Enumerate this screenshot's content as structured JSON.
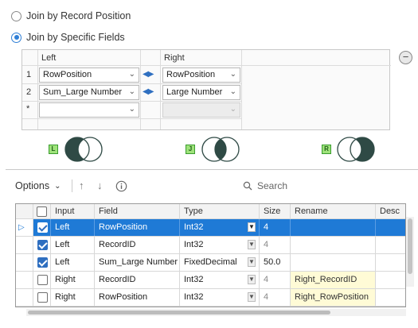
{
  "join_mode": {
    "by_position_label": "Join by Record Position",
    "by_fields_label": "Join by Specific Fields",
    "selected": "by_fields"
  },
  "join_grid": {
    "left_header": "Left",
    "right_header": "Right",
    "rows": [
      {
        "num": "1",
        "left": "RowPosition",
        "right": "RowPosition"
      },
      {
        "num": "2",
        "left": "Sum_Large Number",
        "right": "Large Number"
      },
      {
        "num": "*",
        "left": "",
        "right": ""
      }
    ]
  },
  "venn_outputs": [
    {
      "tag": "L",
      "name": "left-unjoined"
    },
    {
      "tag": "J",
      "name": "joined"
    },
    {
      "tag": "R",
      "name": "right-unjoined"
    }
  ],
  "toolbar": {
    "options_label": "Options",
    "search_placeholder": "Search"
  },
  "field_table": {
    "headers": [
      "Input",
      "Field",
      "Type",
      "Size",
      "Rename",
      "Desc"
    ],
    "rows": [
      {
        "checked": true,
        "input": "Left",
        "field": "RowPosition",
        "type": "Int32",
        "size": "4",
        "rename": "",
        "selected": true
      },
      {
        "checked": true,
        "input": "Left",
        "field": "RecordID",
        "type": "Int32",
        "size": "4",
        "rename": "",
        "selected": false
      },
      {
        "checked": true,
        "input": "Left",
        "field": "Sum_Large Number",
        "type": "FixedDecimal",
        "size": "50.0",
        "rename": "",
        "selected": false
      },
      {
        "checked": false,
        "input": "Right",
        "field": "RecordID",
        "type": "Int32",
        "size": "4",
        "rename": "Right_RecordID",
        "selected": false
      },
      {
        "checked": false,
        "input": "Right",
        "field": "RowPosition",
        "type": "Int32",
        "size": "4",
        "rename": "Right_RowPosition",
        "selected": false
      }
    ]
  },
  "colors": {
    "accent": "#1f7ad6",
    "venn_fill": "#2f4a45",
    "rename_highlight": "#fffbd6"
  }
}
